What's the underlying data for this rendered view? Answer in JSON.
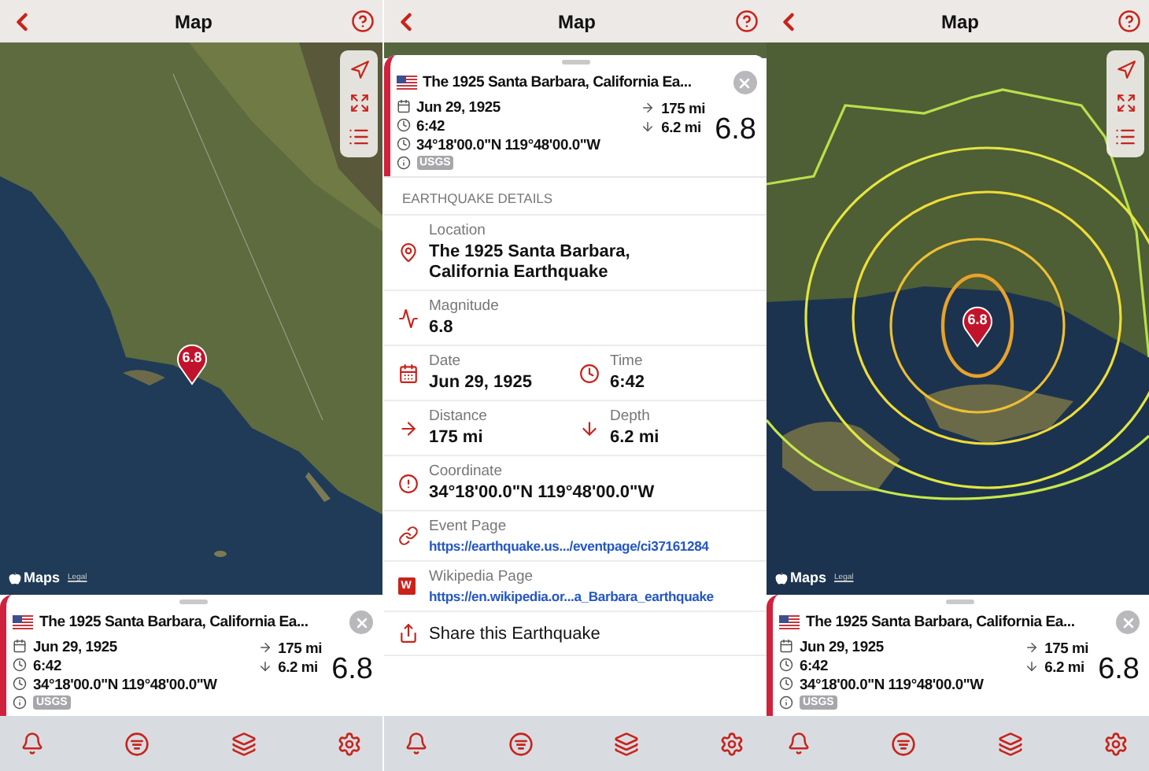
{
  "screens": [
    {
      "kind": "map",
      "nav": {
        "title": "Map"
      },
      "map": {
        "kind": "region",
        "pin": "6.8",
        "attribution": "Maps",
        "legal": "Legal"
      },
      "card": {
        "title": "The 1925 Santa Barbara, California Ea...",
        "date": "Jun 29, 1925",
        "time": "6:42",
        "coordinate": "34°18'00.0\"N 119°48'00.0\"W",
        "source": "USGS",
        "distance": "175 mi",
        "depth": "6.2 mi",
        "magnitude": "6.8"
      }
    },
    {
      "kind": "details",
      "nav": {
        "title": "Map"
      },
      "card": {
        "title": "The 1925 Santa Barbara, California Ea...",
        "date": "Jun 29, 1925",
        "time": "6:42",
        "coordinate": "34°18'00.0\"N 119°48'00.0\"W",
        "source": "USGS",
        "distance": "175 mi",
        "depth": "6.2 mi",
        "magnitude": "6.8"
      },
      "details": {
        "heading": "EARTHQUAKE DETAILS",
        "rows": [
          {
            "kind": "field",
            "items": [
              {
                "label": "Location",
                "value": "The 1925 Santa Barbara, California Earthquake"
              }
            ]
          },
          {
            "kind": "field",
            "items": [
              {
                "label": "Magnitude",
                "value": "6.8"
              }
            ]
          },
          {
            "kind": "pair",
            "items": [
              {
                "label": "Date",
                "value": "Jun 29, 1925"
              },
              {
                "label": "Time",
                "value": "6:42"
              }
            ]
          },
          {
            "kind": "pair",
            "items": [
              {
                "label": "Distance",
                "value": "175 mi"
              },
              {
                "label": "Depth",
                "value": "6.2 mi"
              }
            ]
          },
          {
            "kind": "field",
            "items": [
              {
                "label": "Coordinate",
                "value": "34°18'00.0\"N 119°48'00.0\"W"
              }
            ]
          },
          {
            "kind": "link",
            "items": [
              {
                "label": "Event Page",
                "value": "https://earthquake.us.../eventpage/ci37161284"
              }
            ]
          },
          {
            "kind": "link",
            "icon_letter": "W",
            "items": [
              {
                "label": "Wikipedia Page",
                "value": "https://en.wikipedia.or...a_Barbara_earthquake"
              }
            ]
          },
          {
            "kind": "action",
            "label": "Share this Earthquake"
          }
        ]
      }
    },
    {
      "kind": "map",
      "nav": {
        "title": "Map"
      },
      "map": {
        "kind": "contours",
        "pin": "6.8",
        "attribution": "Maps",
        "legal": "Legal"
      },
      "card": {
        "title": "The 1925 Santa Barbara, California Ea...",
        "date": "Jun 29, 1925",
        "time": "6:42",
        "coordinate": "34°18'00.0\"N 119°48'00.0\"W",
        "source": "USGS",
        "distance": "175 mi",
        "depth": "6.2 mi",
        "magnitude": "6.8"
      }
    }
  ]
}
